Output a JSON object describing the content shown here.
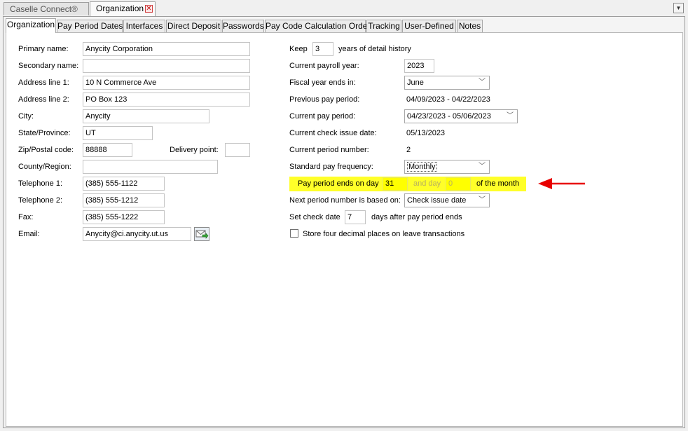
{
  "doc_tabs": [
    {
      "label": "Caselle Connect®"
    },
    {
      "label": "Organization"
    }
  ],
  "sub_tabs": [
    {
      "label": "Organization"
    },
    {
      "label": "Pay Period Dates"
    },
    {
      "label": "Interfaces"
    },
    {
      "label": "Direct Deposit"
    },
    {
      "label": "Passwords"
    },
    {
      "label": "Pay Code Calculation Order"
    },
    {
      "label": "Tracking"
    },
    {
      "label": "User-Defined"
    },
    {
      "label": "Notes"
    }
  ],
  "left": {
    "primary_name": {
      "label": "Primary name:",
      "value": "Anycity Corporation"
    },
    "secondary_name": {
      "label": "Secondary name:",
      "value": ""
    },
    "address1": {
      "label": "Address line 1:",
      "value": "10 N Commerce Ave"
    },
    "address2": {
      "label": "Address line 2:",
      "value": "PO Box 123"
    },
    "city": {
      "label": "City:",
      "value": "Anycity"
    },
    "state": {
      "label": "State/Province:",
      "value": "UT"
    },
    "zip": {
      "label": "Zip/Postal code:",
      "value": "88888"
    },
    "delivery": {
      "label": "Delivery point:",
      "value": ""
    },
    "county": {
      "label": "County/Region:",
      "value": ""
    },
    "phone1": {
      "label": "Telephone 1:",
      "value": "(385) 555-1122"
    },
    "phone2": {
      "label": "Telephone 2:",
      "value": "(385) 555-1212"
    },
    "fax": {
      "label": "Fax:",
      "value": "(385) 555-1222"
    },
    "email": {
      "label": "Email:",
      "value": "Anycity@ci.anycity.ut.us"
    }
  },
  "right": {
    "keep_label": "Keep",
    "keep_value": "3",
    "keep_suffix": "years of detail history",
    "payroll_year": {
      "label": "Current payroll year:",
      "value": "2023"
    },
    "fiscal_end": {
      "label": "Fiscal year ends in:",
      "value": "June"
    },
    "prev_period": {
      "label": "Previous pay period:",
      "value": "04/09/2023 - 04/22/2023"
    },
    "curr_period": {
      "label": "Current pay period:",
      "value": "04/23/2023 - 05/06/2023"
    },
    "check_issue": {
      "label": "Current check issue date:",
      "value": "05/13/2023"
    },
    "period_number": {
      "label": "Current period number:",
      "value": "2"
    },
    "std_freq": {
      "label": "Standard pay frequency:",
      "value": "Monthly"
    },
    "ends_on": {
      "label": "Pay period ends on day",
      "day1": "31",
      "and_day": "and day",
      "day2": "0",
      "suffix": "of the month"
    },
    "next_based": {
      "label": "Next period number is based on:",
      "value": "Check issue date"
    },
    "set_check_label": "Set check date",
    "set_check_value": "7",
    "set_check_suffix": "days after pay period ends",
    "store_decimal": {
      "label": "Store four decimal places on leave transactions",
      "checked": false
    }
  },
  "colors": {
    "highlight": "#ffff29",
    "arrow": "#e80000"
  }
}
